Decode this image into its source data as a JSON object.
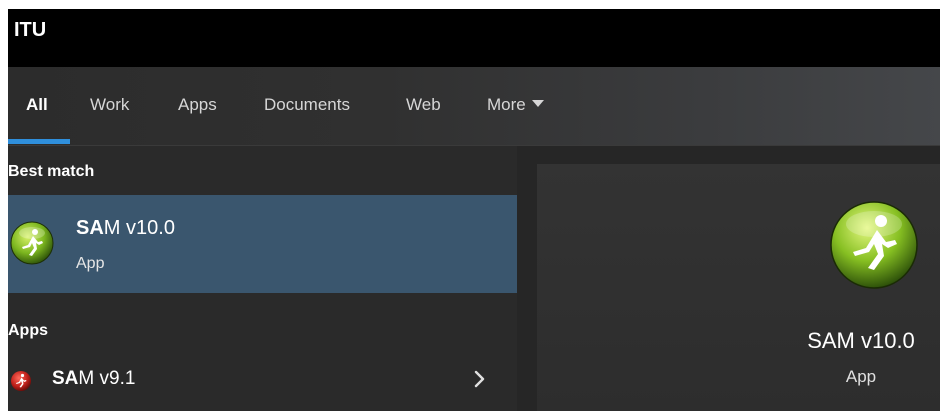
{
  "window": {
    "title": "ITU"
  },
  "tabs": [
    {
      "label": "All"
    },
    {
      "label": "Work"
    },
    {
      "label": "Apps"
    },
    {
      "label": "Documents"
    },
    {
      "label": "Web"
    },
    {
      "label": "More"
    }
  ],
  "active_tab": "All",
  "best_match": {
    "section_label": "Best match",
    "name_bold": "SA",
    "name_rest": "M v10.0",
    "kind": "App",
    "icon": "green-runner-icon"
  },
  "apps": {
    "section_label": "Apps",
    "items": [
      {
        "name_bold": "SA",
        "name_rest": "M v9.1",
        "icon": "red-runner-icon"
      }
    ]
  },
  "preview": {
    "name": "SAM v10.0",
    "kind": "App",
    "icon": "green-runner-icon"
  },
  "colors": {
    "accent": "#2f8fdc",
    "selected_row": "#3a566e",
    "panel": "#2a2a2a"
  }
}
